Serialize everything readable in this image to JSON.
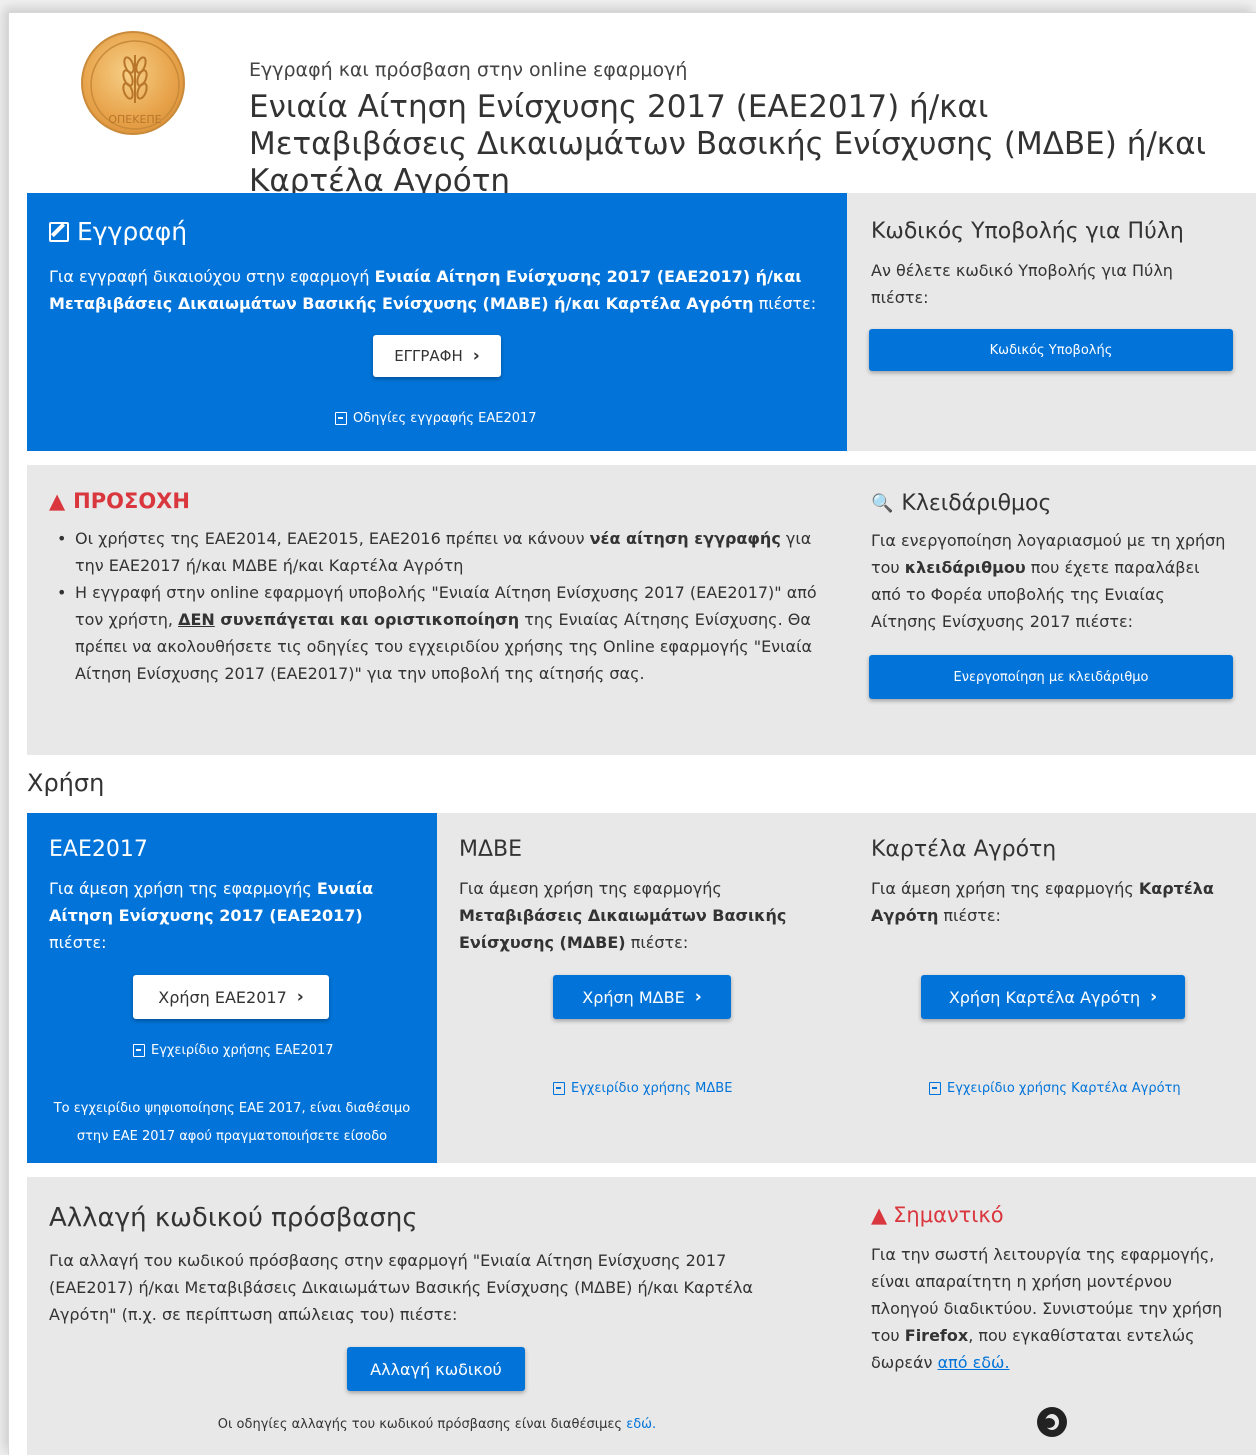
{
  "header": {
    "subtitle": "Εγγραφή και πρόσβαση στην online εφαρμογή",
    "title": "Ενιαία Αίτηση Ενίσχυσης 2017 (ΕΑΕ2017) ή/και Μεταβιβάσεις Δικαιωμάτων Βασικής Ενίσχυσης (ΜΔΒΕ) ή/και Καρτέλα Αγρότη",
    "logo_text": "ΟΠΕΚΕΠΕ"
  },
  "registration": {
    "title": "Εγγραφή",
    "text_pre": "Για εγγραφή δικαιούχου στην εφαρμογή ",
    "text_bold": "Ενιαία Αίτηση Ενίσχυσης 2017 (ΕΑΕ2017) ή/και Μεταβιβάσεις Δικαιωμάτων Βασικής Ενίσχυσης (ΜΔΒΕ) ή/και Καρτέλα Αγρότη",
    "text_post": " πιέστε:",
    "button": "ΕΓΓΡΑΦΗ",
    "guide_link": "Οδηγίες εγγραφής ΕΑΕ2017"
  },
  "portal_code": {
    "title": "Κωδικός Υποβολής για Πύλη",
    "text": "Αν θέλετε κωδικό Υποβολής για Πύλη πιέστε:",
    "button": "Κωδικός Υποβολής"
  },
  "attention": {
    "title": "ΠΡΟΣΟΧΗ",
    "bullet1_pre": "Οι χρήστες της ΕΑΕ2014, ΕΑΕ2015, ΕΑΕ2016 πρέπει να κάνουν ",
    "bullet1_bold": "νέα αίτηση εγγραφής",
    "bullet1_post": " για την ΕΑΕ2017 ή/και ΜΔΒΕ ή/και Καρτέλα Αγρότη",
    "bullet2_pre": "Η εγγραφή στην online εφαρμογή υποβολής \"Ενιαία Αίτηση Ενίσχυσης 2017 (ΕΑΕ2017)\" από τον χρήστη, ",
    "bullet2_underline": "ΔΕΝ",
    "bullet2_bold": " συνεπάγεται και οριστικοποίηση",
    "bullet2_post": " της Ενιαίας Αίτησης Ενίσχυσης. Θα πρέπει να ακολουθήσετε τις οδηγίες του εγχειριδίου χρήσης της Online εφαρμογής \"Ενιαία Αίτηση Ενίσχυσης 2017 (ΕΑΕ2017)\" για την υποβολή της αίτησής σας."
  },
  "passkey": {
    "title": "Κλειδάριθμος",
    "text_pre": "Για ενεργοποίηση λογαριασμού με τη χρήση του ",
    "text_bold": "κλειδάριθμου",
    "text_post": " που έχετε παραλάβει από το Φορέα υποβολής της Ενιαίας Αίτησης Ενίσχυσης 2017 πιέστε:",
    "button": "Ενεργοποίηση με κλειδάριθμο"
  },
  "usage": {
    "heading": "Χρήση",
    "eae": {
      "title": "ΕΑΕ2017",
      "text_pre": "Για άμεση χρήση της εφαρμογής ",
      "text_bold": "Ενιαία Αίτηση Ενίσχυσης 2017 (ΕΑΕ2017)",
      "text_post": " πιέστε:",
      "button": "Χρήση ΕΑΕ2017",
      "manual_link": "Εγχειρίδιο χρήσης ΕΑΕ2017",
      "note": "Το εγχειρίδιο ψηφιοποίησης ΕΑΕ 2017, είναι διαθέσιμο στην ΕΑΕ 2017 αφού πραγματοποιήσετε είσοδο"
    },
    "mdbe": {
      "title": "ΜΔΒΕ",
      "text_pre": "Για άμεση χρήση της εφαρμογής ",
      "text_bold": "Μεταβιβάσεις Δικαιωμάτων Βασικής Ενίσχυσης (ΜΔΒΕ)",
      "text_post": " πιέστε:",
      "button": "Χρήση ΜΔΒΕ",
      "manual_link": "Εγχειρίδιο χρήσης ΜΔΒΕ"
    },
    "farmer": {
      "title": "Καρτέλα Αγρότη",
      "text_pre": "Για άμεση χρήση της εφαρμογής ",
      "text_bold": "Καρτέλα Αγρότη",
      "text_post": " πιέστε:",
      "button": "Χρήση Καρτέλα Αγρότη",
      "manual_link": "Εγχειρίδιο χρήσης Καρτέλα Αγρότη"
    }
  },
  "password_change": {
    "title": "Αλλαγή κωδικού πρόσβασης",
    "text": "Για αλλαγή του κωδικού πρόσβασης στην εφαρμογή \"Ενιαία Αίτηση Ενίσχυσης 2017 (ΕΑΕ2017) ή/και Μεταβιβάσεις Δικαιωμάτων Βασικής Ενίσχυσης (ΜΔΒΕ) ή/και Καρτέλα Αγρότη\" (π.χ. σε περίπτωση απώλειας του) πιέστε:",
    "button": "Αλλαγή κωδικού",
    "note_pre": "Οι οδηγίες αλλαγής του κωδικού πρόσβασης είναι διαθέσιμες ",
    "note_link": "εδώ."
  },
  "important": {
    "title": "Σημαντικό",
    "text_pre": "Για την σωστή λειτουργία της εφαρμογής, είναι απαραίτητη η χρήση μοντέρνου πλοηγού διαδικτύου. Συνιστούμε την χρήση του ",
    "text_bold": "Firefox",
    "text_post": ", που εγκαθίσταται εντελώς δωρεάν ",
    "link": "από εδώ."
  },
  "colors": {
    "blue": "#0274d9",
    "gray": "#e8e8e8",
    "red": "#d9363e"
  }
}
